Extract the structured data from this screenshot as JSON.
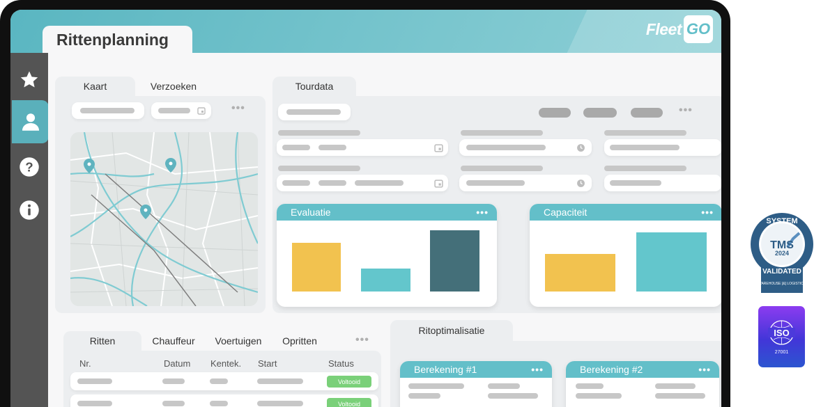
{
  "app": {
    "title": "Rittenplanning",
    "logo_text": "Fleet",
    "logo_box": "GO"
  },
  "sidebar": {
    "items": [
      {
        "name": "favorites",
        "icon": "star-icon",
        "active": false
      },
      {
        "name": "user",
        "icon": "user-icon",
        "active": true
      },
      {
        "name": "help",
        "icon": "question-icon",
        "active": false
      },
      {
        "name": "info",
        "icon": "info-icon",
        "active": false
      }
    ]
  },
  "map_panel": {
    "tabs": [
      {
        "label": "Kaart",
        "active": true
      },
      {
        "label": "Verzoeken",
        "active": false
      }
    ]
  },
  "tour_panel": {
    "tab": "Tourdata"
  },
  "charts": {
    "evaluatie": {
      "title": "Evaluatie"
    },
    "capaciteit": {
      "title": "Capaciteit"
    }
  },
  "chart_data": [
    {
      "type": "bar",
      "title": "Evaluatie",
      "values": [
        0.79,
        0.38,
        1.0
      ],
      "colors": [
        "#f2c24f",
        "#63c6cc",
        "#446f79"
      ]
    },
    {
      "type": "bar",
      "title": "Capaciteit",
      "values": [
        0.64,
        1.0
      ],
      "colors": [
        "#f2c24f",
        "#63c6cc"
      ]
    }
  ],
  "ritten_panel": {
    "tabs": [
      {
        "label": "Ritten",
        "active": true
      },
      {
        "label": "Chauffeur",
        "active": false
      },
      {
        "label": "Voertuigen",
        "active": false
      },
      {
        "label": "Opritten",
        "active": false
      }
    ],
    "columns": [
      "Nr.",
      "Datum",
      "Kentek.",
      "Start",
      "Status"
    ],
    "rows": [
      {
        "status": "Voltooid"
      },
      {
        "status": "Voltooid"
      }
    ]
  },
  "optim_panel": {
    "tab": "Ritoptimalisatie",
    "cards": [
      {
        "title": "Berekening #1"
      },
      {
        "title": "Berekening #2"
      }
    ]
  },
  "badges": {
    "tms": {
      "top": "SYSTEM",
      "main": "TMS",
      "year": "2024",
      "bottom": "VALIDATED",
      "org": "WAREHOUSE [&] LOGISTICS"
    },
    "iso": {
      "main": "ISO",
      "number": "27001"
    }
  },
  "colors": {
    "accent": "#63bfc9",
    "sidebar": "#545454",
    "active": "#5ab0bb",
    "yellow": "#f2c24f",
    "teal": "#63c6cc",
    "dark_teal": "#446f79",
    "success": "#7ad079"
  }
}
